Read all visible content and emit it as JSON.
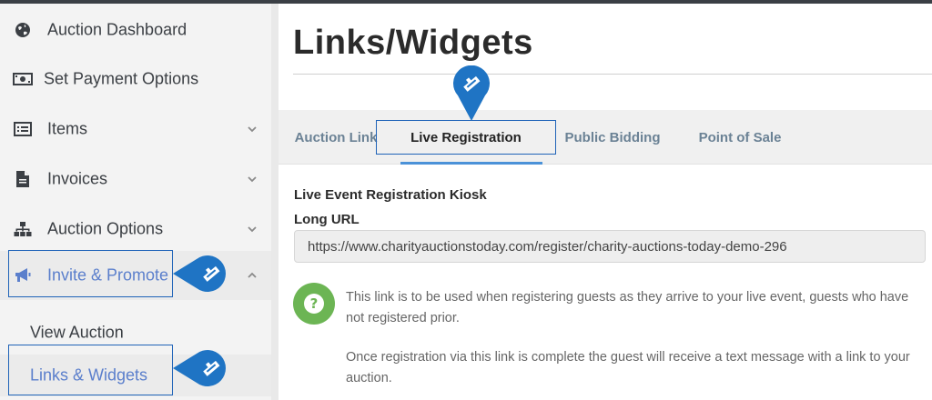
{
  "sidebar": {
    "items": [
      {
        "label": "Auction Dashboard",
        "icon": "globe-icon"
      },
      {
        "label": "Set Payment Options",
        "icon": "money-icon"
      },
      {
        "label": "Items",
        "icon": "list-icon"
      },
      {
        "label": "Invoices",
        "icon": "document-icon"
      },
      {
        "label": "Auction Options",
        "icon": "sitemap-icon"
      },
      {
        "label": "Invite & Promote",
        "icon": "megaphone-icon"
      }
    ],
    "sub_items": [
      {
        "label": "View Auction"
      },
      {
        "label": "Links & Widgets"
      }
    ]
  },
  "main": {
    "title": "Links/Widgets",
    "tabs": [
      {
        "label": "Auction Link"
      },
      {
        "label": "Live Registration"
      },
      {
        "label": "Public Bidding"
      },
      {
        "label": "Point of Sale"
      }
    ],
    "section_title": "Live Event Registration Kiosk",
    "url_label": "Long URL",
    "url_value": "https://www.charityauctionstoday.com/register/charity-auctions-today-demo-296",
    "help_text_1": "This link is to be used when registering guests as they arrive to your live event, guests who have not registered prior.",
    "help_text_2": "Once registration via this link is complete the guest will receive a text message with a link to your auction."
  },
  "colors": {
    "accent": "#5b7fcc",
    "pin": "#1f74c4",
    "help_green": "#6cb554",
    "tab_underline": "#4b92d8"
  }
}
